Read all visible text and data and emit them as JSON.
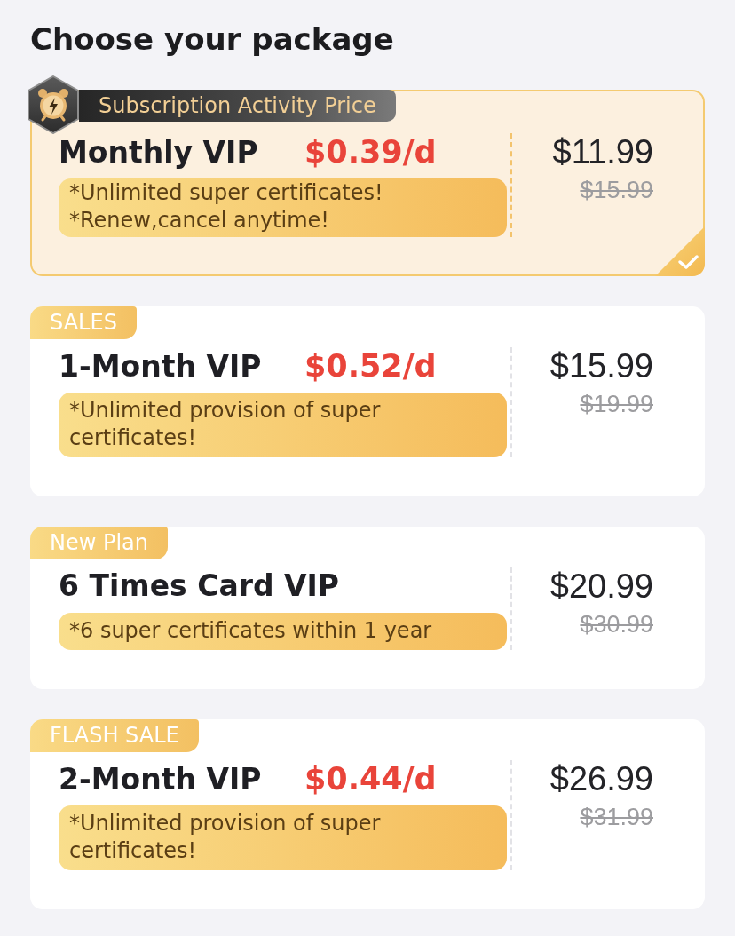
{
  "page": {
    "title": "Choose your package"
  },
  "packages": [
    {
      "tag": {
        "kind": "activity",
        "text": "Subscription Activity Price"
      },
      "name": "Monthly VIP",
      "per_day": "$0.39/d",
      "features": [
        "*Unlimited super certificates!",
        "*Renew,cancel anytime!"
      ],
      "price": "$11.99",
      "original_price": "$15.99",
      "selected": true
    },
    {
      "tag": {
        "kind": "ribbon",
        "text": "SALES"
      },
      "name": "1-Month VIP",
      "per_day": "$0.52/d",
      "features": [
        "*Unlimited provision of super certificates!"
      ],
      "price": "$15.99",
      "original_price": "$19.99",
      "selected": false
    },
    {
      "tag": {
        "kind": "ribbon",
        "text": "New Plan"
      },
      "name": "6 Times Card VIP",
      "features": [
        "*6 super certificates within 1 year"
      ],
      "price": "$20.99",
      "original_price": "$30.99",
      "selected": false
    },
    {
      "tag": {
        "kind": "ribbon",
        "text": "FLASH SALE"
      },
      "name": "2-Month VIP",
      "per_day": "$0.44/d",
      "features": [
        "*Unlimited provision of super certificates!"
      ],
      "price": "$26.99",
      "original_price": "$31.99",
      "selected": false
    }
  ]
}
